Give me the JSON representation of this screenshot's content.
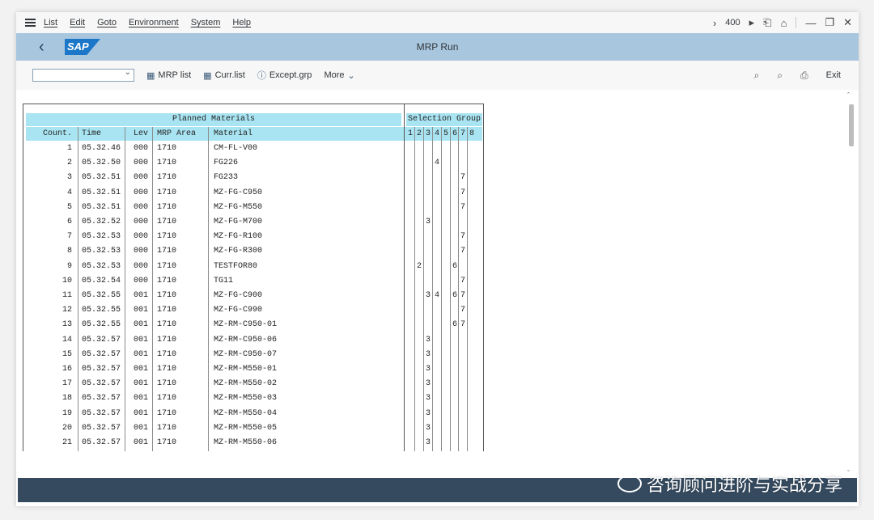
{
  "menu": [
    "List",
    "Edit",
    "Goto",
    "Environment",
    "System",
    "Help"
  ],
  "system": {
    "client": "400"
  },
  "title": "MRP Run",
  "toolbar": {
    "buttons": [
      {
        "label": "MRP list",
        "icon": "table-icon"
      },
      {
        "label": "Curr.list",
        "icon": "table-icon"
      },
      {
        "label": "Except.grp",
        "icon": "info-icon"
      },
      {
        "label": "More",
        "icon": "chevron-down-icon"
      }
    ],
    "exit_label": "Exit"
  },
  "list": {
    "group_header_planned": "Planned Materials",
    "group_header_selection": "Selection Group",
    "columns": {
      "count": "Count.",
      "time": "Time",
      "lev": "Lev",
      "area": "MRP Area",
      "material": "Material"
    },
    "group_numbers": [
      "1",
      "2",
      "3",
      "4",
      "5",
      "6",
      "7",
      "8"
    ],
    "rows": [
      {
        "count": "1",
        "time": "05.32.46",
        "lev": "000",
        "area": "1710",
        "material": "CM-FL-V00",
        "g": [
          "",
          "",
          "",
          "",
          "",
          "",
          "",
          ""
        ]
      },
      {
        "count": "2",
        "time": "05.32.50",
        "lev": "000",
        "area": "1710",
        "material": "FG226",
        "g": [
          "",
          "",
          "",
          "4",
          "",
          "",
          "",
          ""
        ]
      },
      {
        "count": "3",
        "time": "05.32.51",
        "lev": "000",
        "area": "1710",
        "material": "FG233",
        "g": [
          "",
          "",
          "",
          "",
          "",
          "",
          "7",
          ""
        ]
      },
      {
        "count": "4",
        "time": "05.32.51",
        "lev": "000",
        "area": "1710",
        "material": "MZ-FG-C950",
        "g": [
          "",
          "",
          "",
          "",
          "",
          "",
          "7",
          ""
        ]
      },
      {
        "count": "5",
        "time": "05.32.51",
        "lev": "000",
        "area": "1710",
        "material": "MZ-FG-M550",
        "g": [
          "",
          "",
          "",
          "",
          "",
          "",
          "7",
          ""
        ]
      },
      {
        "count": "6",
        "time": "05.32.52",
        "lev": "000",
        "area": "1710",
        "material": "MZ-FG-M700",
        "g": [
          "",
          "",
          "3",
          "",
          "",
          "",
          "",
          ""
        ]
      },
      {
        "count": "7",
        "time": "05.32.53",
        "lev": "000",
        "area": "1710",
        "material": "MZ-FG-R100",
        "g": [
          "",
          "",
          "",
          "",
          "",
          "",
          "7",
          ""
        ]
      },
      {
        "count": "8",
        "time": "05.32.53",
        "lev": "000",
        "area": "1710",
        "material": "MZ-FG-R300",
        "g": [
          "",
          "",
          "",
          "",
          "",
          "",
          "7",
          ""
        ]
      },
      {
        "count": "9",
        "time": "05.32.53",
        "lev": "000",
        "area": "1710",
        "material": "TESTFOR80",
        "g": [
          "",
          "2",
          "",
          "",
          "",
          "6",
          "",
          ""
        ]
      },
      {
        "count": "10",
        "time": "05.32.54",
        "lev": "000",
        "area": "1710",
        "material": "TG11",
        "g": [
          "",
          "",
          "",
          "",
          "",
          "",
          "7",
          ""
        ]
      },
      {
        "count": "11",
        "time": "05.32.55",
        "lev": "001",
        "area": "1710",
        "material": "MZ-FG-C900",
        "g": [
          "",
          "",
          "3",
          "4",
          "",
          "6",
          "7",
          ""
        ]
      },
      {
        "count": "12",
        "time": "05.32.55",
        "lev": "001",
        "area": "1710",
        "material": "MZ-FG-C990",
        "g": [
          "",
          "",
          "",
          "",
          "",
          "",
          "7",
          ""
        ]
      },
      {
        "count": "13",
        "time": "05.32.55",
        "lev": "001",
        "area": "1710",
        "material": "MZ-RM-C950-01",
        "g": [
          "",
          "",
          "",
          "",
          "",
          "6",
          "7",
          ""
        ]
      },
      {
        "count": "14",
        "time": "05.32.57",
        "lev": "001",
        "area": "1710",
        "material": "MZ-RM-C950-06",
        "g": [
          "",
          "",
          "3",
          "",
          "",
          "",
          "",
          ""
        ]
      },
      {
        "count": "15",
        "time": "05.32.57",
        "lev": "001",
        "area": "1710",
        "material": "MZ-RM-C950-07",
        "g": [
          "",
          "",
          "3",
          "",
          "",
          "",
          "",
          ""
        ]
      },
      {
        "count": "16",
        "time": "05.32.57",
        "lev": "001",
        "area": "1710",
        "material": "MZ-RM-M550-01",
        "g": [
          "",
          "",
          "3",
          "",
          "",
          "",
          "",
          ""
        ]
      },
      {
        "count": "17",
        "time": "05.32.57",
        "lev": "001",
        "area": "1710",
        "material": "MZ-RM-M550-02",
        "g": [
          "",
          "",
          "3",
          "",
          "",
          "",
          "",
          ""
        ]
      },
      {
        "count": "18",
        "time": "05.32.57",
        "lev": "001",
        "area": "1710",
        "material": "MZ-RM-M550-03",
        "g": [
          "",
          "",
          "3",
          "",
          "",
          "",
          "",
          ""
        ]
      },
      {
        "count": "19",
        "time": "05.32.57",
        "lev": "001",
        "area": "1710",
        "material": "MZ-RM-M550-04",
        "g": [
          "",
          "",
          "3",
          "",
          "",
          "",
          "",
          ""
        ]
      },
      {
        "count": "20",
        "time": "05.32.57",
        "lev": "001",
        "area": "1710",
        "material": "MZ-RM-M550-05",
        "g": [
          "",
          "",
          "3",
          "",
          "",
          "",
          "",
          ""
        ]
      },
      {
        "count": "21",
        "time": "05.32.57",
        "lev": "001",
        "area": "1710",
        "material": "MZ-RM-M550-06",
        "g": [
          "",
          "",
          "3",
          "",
          "",
          "",
          "",
          ""
        ]
      }
    ]
  },
  "watermark": "咨询顾问进阶与实战分享",
  "colors": {
    "titlebar": "#a8c6de",
    "list_header": "#a9e4f2",
    "statusbar": "#354a5f",
    "sap_blue": "#1c77c8"
  }
}
